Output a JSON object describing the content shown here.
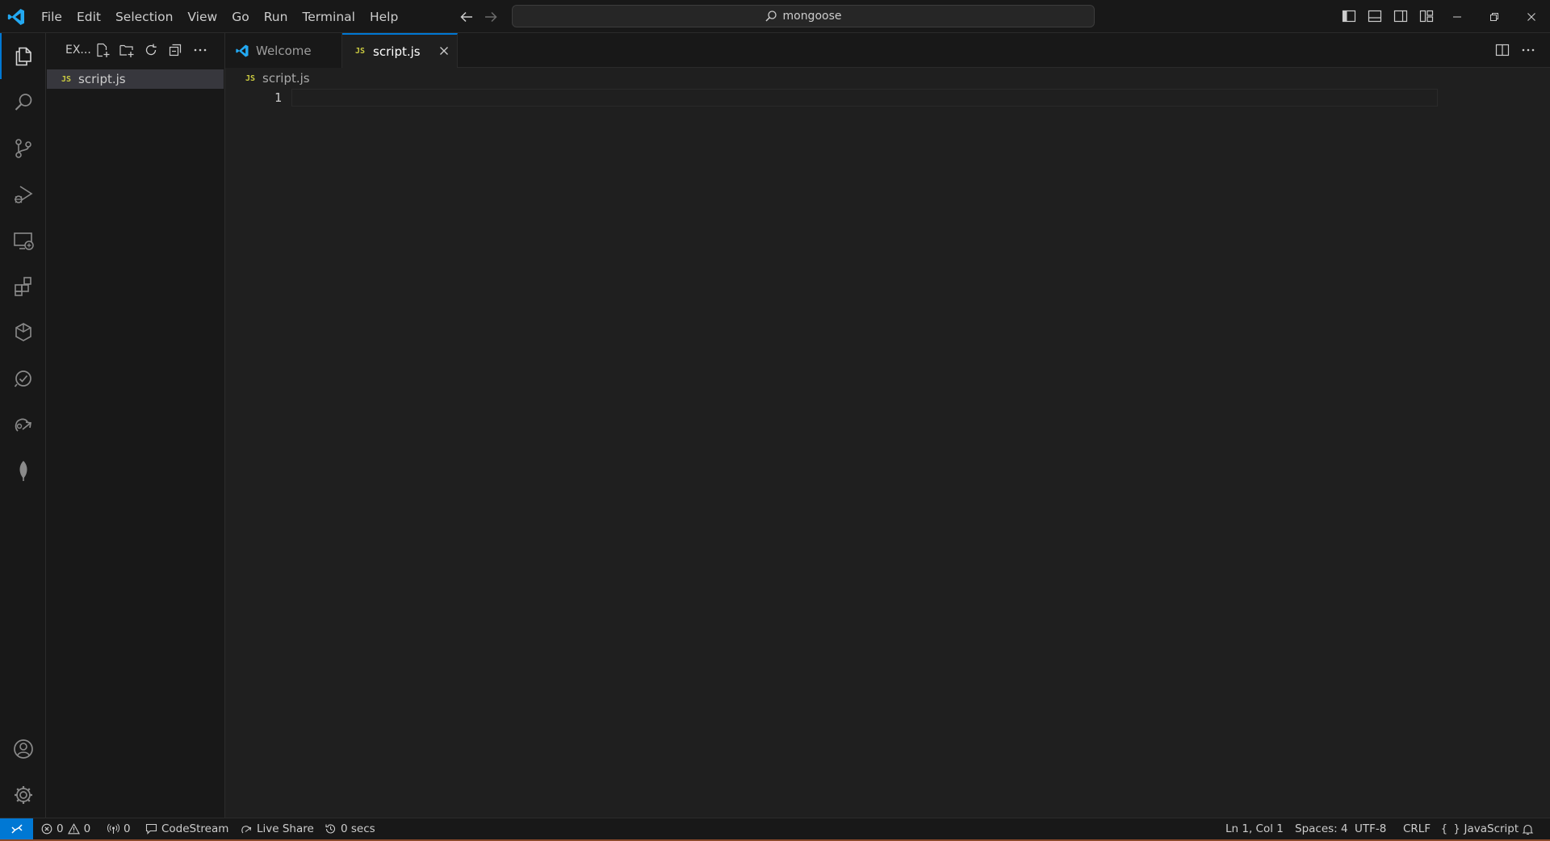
{
  "menu": [
    "File",
    "Edit",
    "Selection",
    "View",
    "Go",
    "Run",
    "Terminal",
    "Help"
  ],
  "search": {
    "text": "mongoose"
  },
  "sidebar": {
    "title": "EX...",
    "files": [
      {
        "icon": "JS",
        "name": "script.js"
      }
    ]
  },
  "tabs": [
    {
      "label": "Welcome"
    },
    {
      "icon": "JS",
      "label": "script.js"
    }
  ],
  "breadcrumb": {
    "icon": "JS",
    "file": "script.js"
  },
  "editor": {
    "line_numbers": [
      "1"
    ]
  },
  "statusbar": {
    "errors": "0",
    "warnings": "0",
    "ports": "0",
    "codestream": "CodeStream",
    "live_share": "Live Share",
    "time": "0 secs",
    "position": "Ln 1, Col 1",
    "spaces": "Spaces: 4",
    "encoding": "UTF-8",
    "eol": "CRLF",
    "language": "JavaScript"
  },
  "colors": {
    "accent": "#0078d4",
    "js_badge": "#cbcb41",
    "vscode_logo": "#23a9f2",
    "background": "#1f1f1f",
    "chrome": "#181818"
  }
}
